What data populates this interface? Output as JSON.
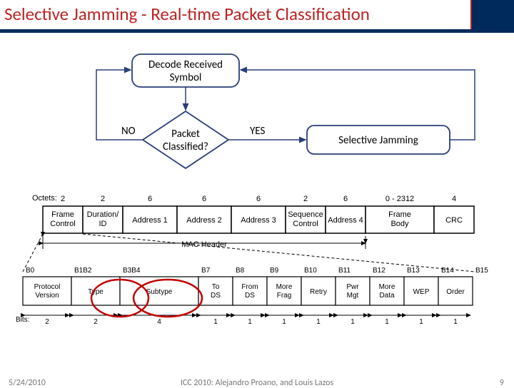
{
  "title": "Selective Jamming - Real-time Packet Classification",
  "flow": {
    "decode": "Decode Received\nSymbol",
    "decision": "Packet\nClassified?",
    "no": "NO",
    "yes": "YES",
    "jam": "Selective Jamming"
  },
  "mac": {
    "octetsLabel": "Octets:",
    "octets": [
      "2",
      "2",
      "6",
      "6",
      "6",
      "2",
      "6",
      "0 - 2312",
      "4"
    ],
    "fields": [
      "Frame\nControl",
      "Duration/\nID",
      "Address 1",
      "Address 2",
      "Address 3",
      "Sequence\nControl",
      "Address 4",
      "Frame\nBody",
      "CRC"
    ],
    "header": "MAC Header"
  },
  "fc": {
    "bLabels": [
      "B0",
      "B1B2",
      "B3B4",
      "B7",
      "B8",
      "B9",
      "B10",
      "B11",
      "B12",
      "B13",
      "B14",
      "B15"
    ],
    "fields": [
      "Protocol\nVersion",
      "Type",
      "Subtype",
      "To\nDS",
      "From\nDS",
      "More\nFrag",
      "Retry",
      "Pwr\nMgt",
      "More\nData",
      "WEP",
      "Order"
    ],
    "bitsLabel": "Bits:",
    "bits": [
      "2",
      "2",
      "4",
      "1",
      "1",
      "1",
      "1",
      "1",
      "1",
      "1",
      "1"
    ]
  },
  "footer": {
    "date": "5/24/2010",
    "credit": "ICC 2010:  Alejandro Proano, and Louis Lazos",
    "page": "9"
  }
}
